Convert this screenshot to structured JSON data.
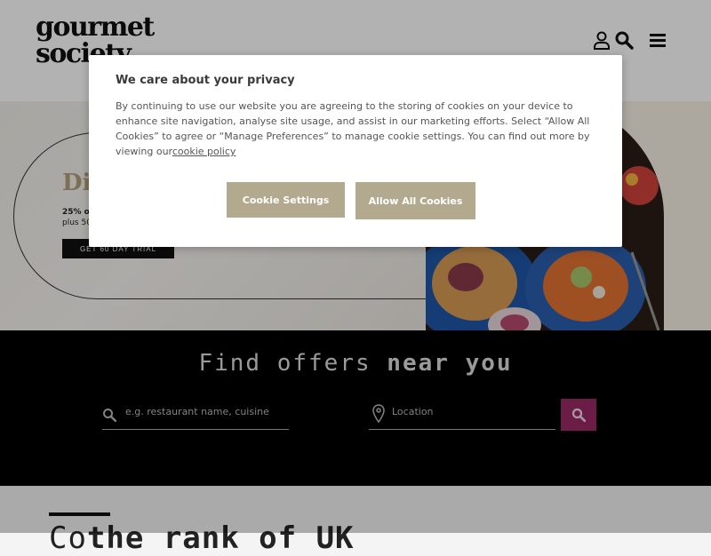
{
  "header": {
    "logo_line1": "gourmet",
    "logo_line2": "society",
    "icons": [
      "user-icon",
      "search-icon",
      "menu-icon"
    ]
  },
  "hero": {
    "title_partial": "Di",
    "line1_partial": "25% off",
    "line2_partial": "plus 50",
    "cta": "GET 60 DAY TRIAL",
    "accent_color": "#b3a077"
  },
  "cookie_modal": {
    "title": "We care about your privacy",
    "body": "By continuing to use our website you are agreeing to the storing of cookies on your device to enhance site navigation, analyse site usage, and assist in our marketing efforts. Select “Allow All Cookies” to agree or “Manage Preferences” to manage cookie settings. You can find out more by viewing our",
    "link": "cookie policy",
    "settings_button": "Cookie Settings",
    "allow_button": "Allow All Cookies",
    "button_color": "#b2a98f"
  },
  "find": {
    "title_plain": "Find offers ",
    "title_bold": "near you",
    "search_placeholder": "e.g. restaurant name, cuisine",
    "location_placeholder": "Location",
    "search_button_color": "#9a2a67"
  },
  "below": {
    "heading_plain": "Co",
    "heading_bold": "the rank of UK"
  }
}
